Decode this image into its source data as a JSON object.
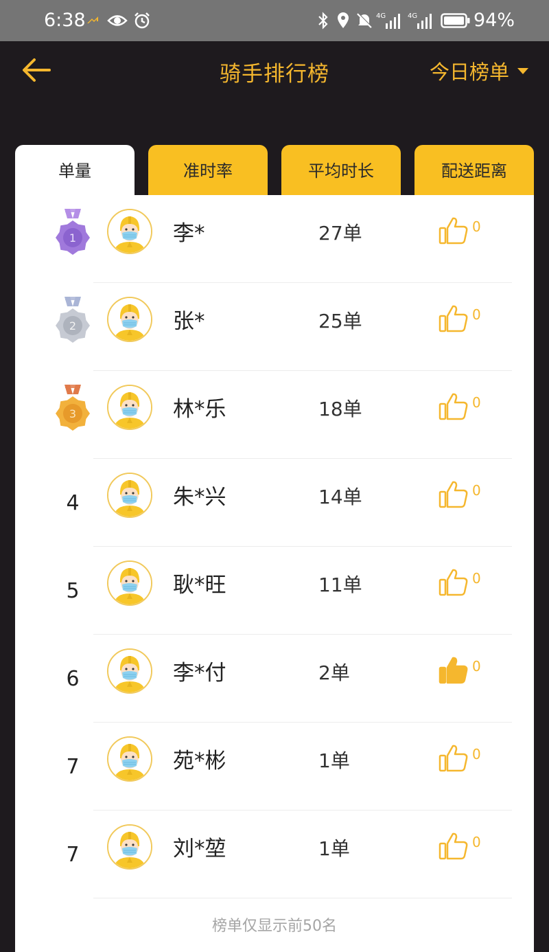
{
  "status_bar": {
    "time": "6:38",
    "battery": "94%",
    "icons": [
      "notification-icon",
      "eye-icon",
      "alarm-icon",
      "bluetooth-icon",
      "location-icon",
      "mute-icon",
      "signal-4g-icon",
      "signal-4g-icon",
      "battery-icon"
    ]
  },
  "header": {
    "title": "骑手排行榜",
    "period": "今日榜单",
    "accent": "#f5b72e"
  },
  "tabs": [
    "单量",
    "准时率",
    "平均时长",
    "配送距离"
  ],
  "active_tab": 0,
  "riders": [
    {
      "rank": "1",
      "medal": "purple",
      "name": "李*",
      "count": "27单",
      "likes": "0",
      "liked": false
    },
    {
      "rank": "2",
      "medal": "silver",
      "name": "张*",
      "count": "25单",
      "likes": "0",
      "liked": false
    },
    {
      "rank": "3",
      "medal": "bronze",
      "name": "林*乐",
      "count": "18单",
      "likes": "0",
      "liked": false
    },
    {
      "rank": "4",
      "medal": "",
      "name": "朱*兴",
      "count": "14单",
      "likes": "0",
      "liked": false
    },
    {
      "rank": "5",
      "medal": "",
      "name": "耿*旺",
      "count": "11单",
      "likes": "0",
      "liked": false
    },
    {
      "rank": "6",
      "medal": "",
      "name": "李*付",
      "count": "2单",
      "likes": "0",
      "liked": true
    },
    {
      "rank": "7",
      "medal": "",
      "name": "苑*彬",
      "count": "1单",
      "likes": "0",
      "liked": false
    },
    {
      "rank": "7",
      "medal": "",
      "name": "刘*堃",
      "count": "1单",
      "likes": "0",
      "liked": false
    }
  ],
  "footer_note": "榜单仅显示前50名"
}
